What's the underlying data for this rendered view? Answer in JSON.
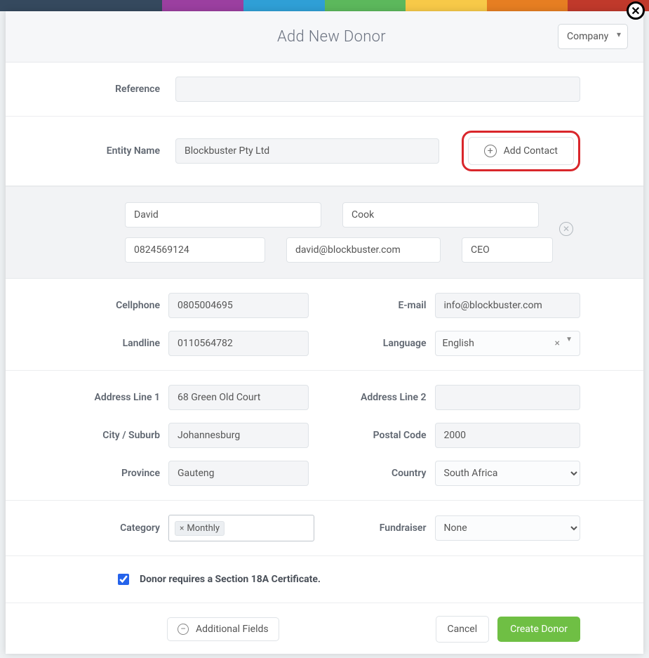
{
  "header": {
    "title": "Add New Donor",
    "donor_type": "Company"
  },
  "labels": {
    "reference": "Reference",
    "entity_name": "Entity Name",
    "add_contact": "Add Contact",
    "cellphone": "Cellphone",
    "email": "E-mail",
    "landline": "Landline",
    "language": "Language",
    "address1": "Address Line 1",
    "address2": "Address Line 2",
    "city": "City / Suburb",
    "postal": "Postal Code",
    "province": "Province",
    "country": "Country",
    "category": "Category",
    "fundraiser": "Fundraiser",
    "section18a": "Donor requires a Section 18A Certificate.",
    "additional_fields": "Additional Fields",
    "cancel": "Cancel",
    "create": "Create Donor"
  },
  "values": {
    "reference": "",
    "entity_name": "Blockbuster Pty Ltd",
    "contact": {
      "first_name": "David",
      "last_name": "Cook",
      "mobile": "0824569124",
      "email": "david@blockbuster.com",
      "title": "CEO"
    },
    "cellphone": "0805004695",
    "email": "info@blockbuster.com",
    "landline": "0110564782",
    "language": "English",
    "address1": "68 Green Old Court",
    "address2": "",
    "city": "Johannesburg",
    "postal": "2000",
    "province": "Gauteng",
    "country": "South Africa",
    "category_tags": [
      "Monthly"
    ],
    "fundraiser": "None",
    "section18a_checked": true
  }
}
